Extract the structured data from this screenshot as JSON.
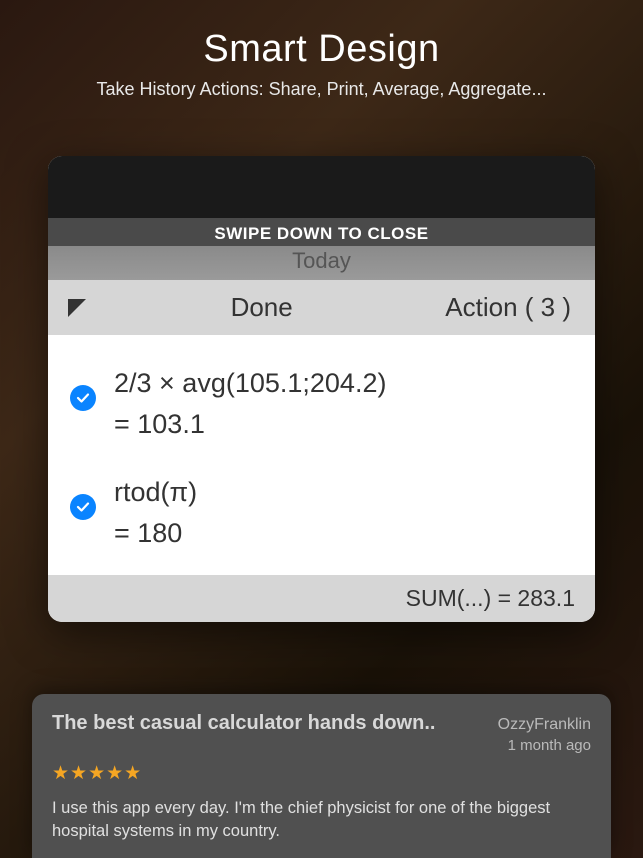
{
  "header": {
    "title": "Smart Design",
    "subtitle": "Take History Actions: Share, Print, Average, Aggregate..."
  },
  "panel": {
    "swipe_hint": "SWIPE DOWN TO CLOSE",
    "date_label": "Today",
    "done_label": "Done",
    "action_label": "Action ( 3 )",
    "sum_label": "SUM(...) = 283.1"
  },
  "history": [
    {
      "expression": "2/3 × avg(105.1;204.2)",
      "result": "= 103.1"
    },
    {
      "expression": "rtod(π)",
      "result": "= 180"
    }
  ],
  "review": {
    "title": "The best casual calculator hands down..",
    "author": "OzzyFranklin",
    "date": "1 month ago",
    "stars": "★★★★★",
    "body": "I use this app every day. I'm the chief physicist for one of the biggest hospital systems in my country."
  }
}
